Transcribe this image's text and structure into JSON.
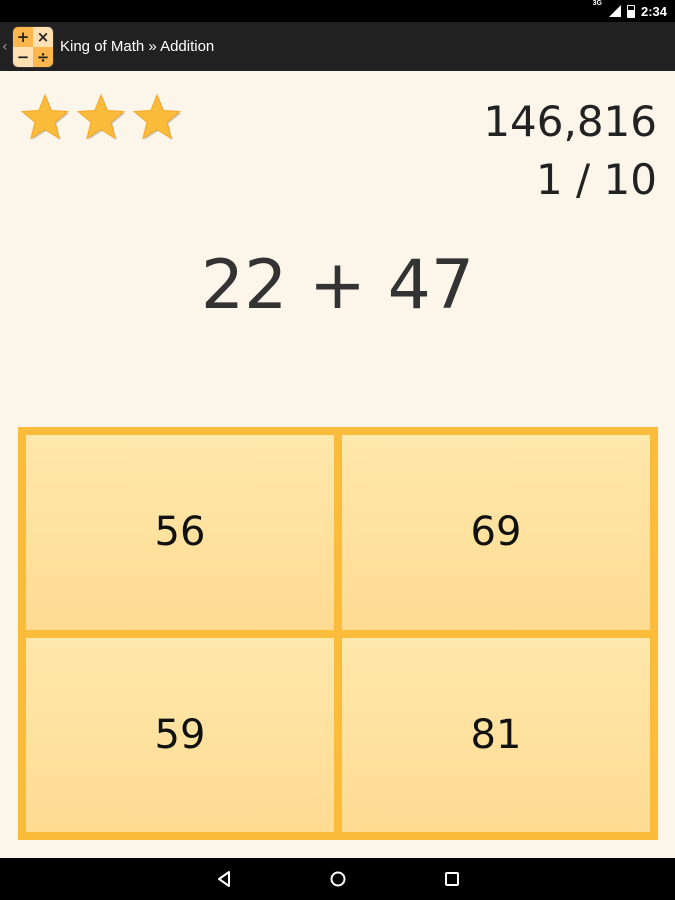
{
  "status_bar": {
    "network": "3G",
    "time": "2:34"
  },
  "action_bar": {
    "title": "King of Math » Addition",
    "icon_symbols": [
      "+",
      "×",
      "−",
      "÷"
    ]
  },
  "game": {
    "stars": 3,
    "score": "146,816",
    "progress": "1 / 10",
    "question": "22 + 47",
    "answers": [
      "56",
      "69",
      "59",
      "81"
    ]
  },
  "colors": {
    "star": "#fbbc3c",
    "answer_border": "#fbbc3c",
    "answer_bg": "#ffe3a0",
    "content_bg": "#fbf5ea"
  }
}
